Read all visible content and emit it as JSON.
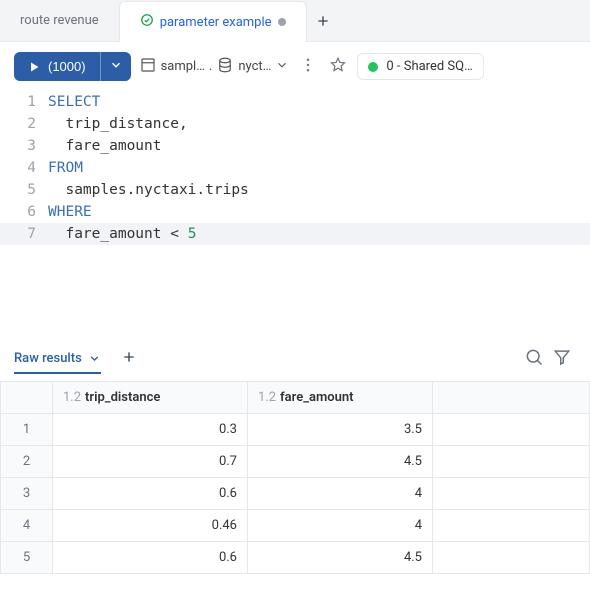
{
  "tabs": [
    {
      "label": "route revenue"
    },
    {
      "label": "parameter example"
    }
  ],
  "toolbar": {
    "run_label": "(1000)",
    "catalog_first": "sampl…",
    "catalog_second": "nyct…",
    "compute_label": "0 - Shared SQ…"
  },
  "editor": {
    "lines": [
      {
        "n": "1",
        "kw": "SELECT",
        "rest": ""
      },
      {
        "n": "2",
        "kw": "",
        "rest": "  trip_distance,"
      },
      {
        "n": "3",
        "kw": "",
        "rest": "  fare_amount"
      },
      {
        "n": "4",
        "kw": "FROM",
        "rest": ""
      },
      {
        "n": "5",
        "kw": "",
        "rest": "  samples.nyctaxi.trips"
      },
      {
        "n": "6",
        "kw": "WHERE",
        "rest": ""
      },
      {
        "n": "7",
        "kw": "",
        "rest_prefix": "  fare_amount < ",
        "num": "5"
      }
    ]
  },
  "results": {
    "tab_label": "Raw results",
    "columns": [
      {
        "type": "1.2",
        "name": "trip_distance"
      },
      {
        "type": "1.2",
        "name": "fare_amount"
      }
    ],
    "rows": [
      {
        "idx": "1",
        "c1": "0.3",
        "c2": "3.5"
      },
      {
        "idx": "2",
        "c1": "0.7",
        "c2": "4.5"
      },
      {
        "idx": "3",
        "c1": "0.6",
        "c2": "4"
      },
      {
        "idx": "4",
        "c1": "0.46",
        "c2": "4"
      },
      {
        "idx": "5",
        "c1": "0.6",
        "c2": "4.5"
      }
    ]
  },
  "chart_data": {
    "type": "table",
    "columns": [
      "trip_distance",
      "fare_amount"
    ],
    "rows": [
      [
        0.3,
        3.5
      ],
      [
        0.7,
        4.5
      ],
      [
        0.6,
        4
      ],
      [
        0.46,
        4
      ],
      [
        0.6,
        4.5
      ]
    ]
  }
}
